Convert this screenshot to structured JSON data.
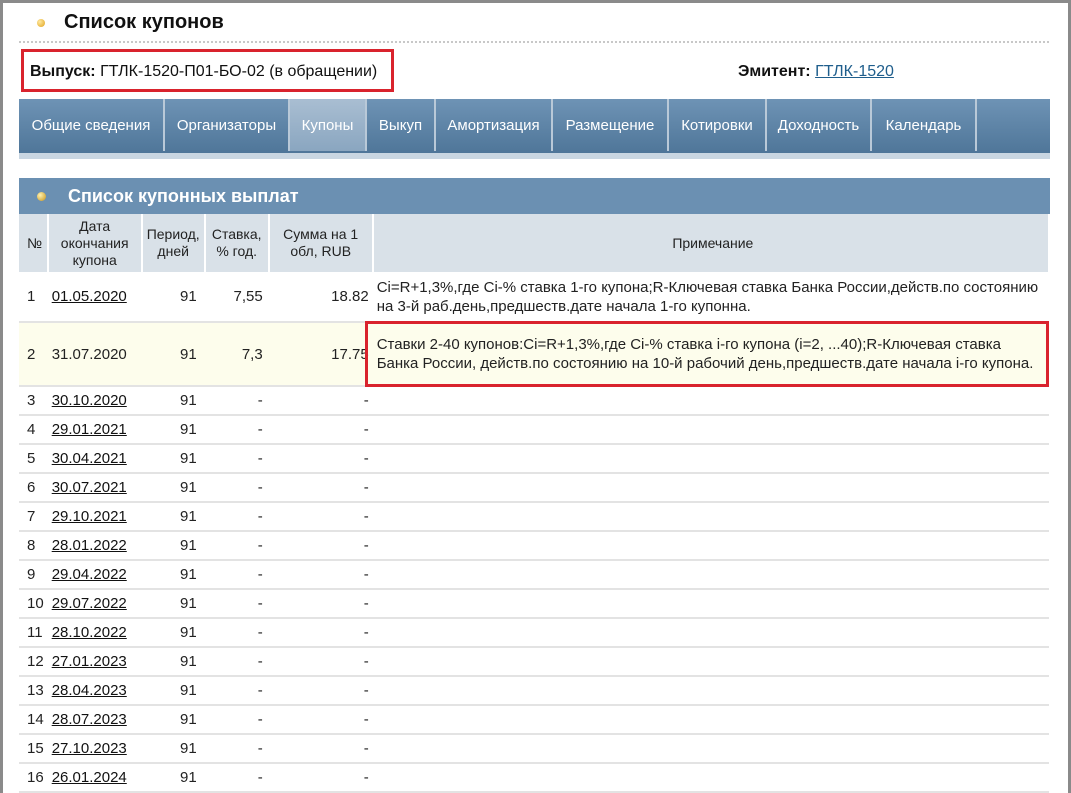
{
  "header": {
    "title": "Список купонов",
    "issue_label": "Выпуск:",
    "issue_value": "ГТЛК-1520-П01-БО-02 (в обращении)",
    "emitter_label": "Эмитент:",
    "emitter_value": "ГТЛК-1520"
  },
  "tabs": [
    {
      "label": "Общие сведения"
    },
    {
      "label": "Организаторы"
    },
    {
      "label": "Купоны"
    },
    {
      "label": "Выкуп"
    },
    {
      "label": "Амортизация"
    },
    {
      "label": "Размещение"
    },
    {
      "label": "Котировки"
    },
    {
      "label": "Доходность"
    },
    {
      "label": "Календарь"
    }
  ],
  "section": {
    "title": "Список купонных выплат"
  },
  "columns": {
    "num": "№",
    "date": "Дата окончания купона",
    "period": "Период, дней",
    "rate": "Ставка, % год.",
    "sum": "Сумма на 1 обл, RUB",
    "note": "Примечание"
  },
  "rows": [
    {
      "num": "1",
      "date": "01.05.2020",
      "period": "91",
      "rate": "7,55",
      "sum": "18.82",
      "note": "Ci=R+1,3%,где Ci-% ставка 1-го купона;R-Ключевая ставка Банка России,действ.по состоянию на 3-й раб.день,предшеств.дате начала 1-го купонна."
    },
    {
      "num": "2",
      "date": "31.07.2020",
      "period": "91",
      "rate": "7,3",
      "sum": "17.75",
      "note": "Ставки 2-40 купонов:Ci=R+1,3%,где Ci-% ставка i-го купона (i=2, ...40);R-Ключевая ставка Банка России, действ.по состоянию на 10-й рабочий день,предшеств.дате начала i-го купона."
    },
    {
      "num": "3",
      "date": "30.10.2020",
      "period": "91",
      "rate": "-",
      "sum": "-",
      "note": ""
    },
    {
      "num": "4",
      "date": "29.01.2021",
      "period": "91",
      "rate": "-",
      "sum": "-",
      "note": ""
    },
    {
      "num": "5",
      "date": "30.04.2021",
      "period": "91",
      "rate": "-",
      "sum": "-",
      "note": ""
    },
    {
      "num": "6",
      "date": "30.07.2021",
      "period": "91",
      "rate": "-",
      "sum": "-",
      "note": ""
    },
    {
      "num": "7",
      "date": "29.10.2021",
      "period": "91",
      "rate": "-",
      "sum": "-",
      "note": ""
    },
    {
      "num": "8",
      "date": "28.01.2022",
      "period": "91",
      "rate": "-",
      "sum": "-",
      "note": ""
    },
    {
      "num": "9",
      "date": "29.04.2022",
      "period": "91",
      "rate": "-",
      "sum": "-",
      "note": ""
    },
    {
      "num": "10",
      "date": "29.07.2022",
      "period": "91",
      "rate": "-",
      "sum": "-",
      "note": ""
    },
    {
      "num": "11",
      "date": "28.10.2022",
      "period": "91",
      "rate": "-",
      "sum": "-",
      "note": ""
    },
    {
      "num": "12",
      "date": "27.01.2023",
      "period": "91",
      "rate": "-",
      "sum": "-",
      "note": ""
    },
    {
      "num": "13",
      "date": "28.04.2023",
      "period": "91",
      "rate": "-",
      "sum": "-",
      "note": ""
    },
    {
      "num": "14",
      "date": "28.07.2023",
      "period": "91",
      "rate": "-",
      "sum": "-",
      "note": ""
    },
    {
      "num": "15",
      "date": "27.10.2023",
      "period": "91",
      "rate": "-",
      "sum": "-",
      "note": ""
    },
    {
      "num": "16",
      "date": "26.01.2024",
      "period": "91",
      "rate": "-",
      "sum": "-",
      "note": ""
    }
  ]
}
